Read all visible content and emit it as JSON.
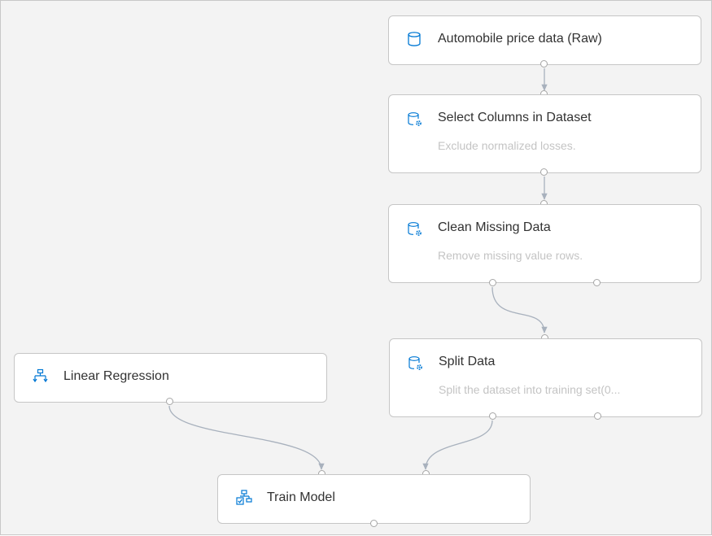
{
  "pipeline": {
    "nodes": {
      "automobile": {
        "title": "Automobile price data (Raw)",
        "icon": "dataset-icon"
      },
      "select_columns": {
        "title": "Select Columns in Dataset",
        "description": "Exclude normalized losses.",
        "icon": "dataset-gear-icon"
      },
      "clean_missing": {
        "title": "Clean Missing Data",
        "description": "Remove missing value rows.",
        "icon": "dataset-gear-icon"
      },
      "split_data": {
        "title": "Split Data",
        "description": "Split the dataset into training set(0...",
        "icon": "dataset-gear-icon"
      },
      "linear_regression": {
        "title": "Linear Regression",
        "icon": "regression-tree-icon"
      },
      "train_model": {
        "title": "Train Model",
        "icon": "train-model-icon"
      }
    }
  },
  "colors": {
    "accent": "#0078d4",
    "edge": "#a8b1bd",
    "port_border": "#a6a6a6",
    "canvas_bg": "#f3f3f3"
  }
}
